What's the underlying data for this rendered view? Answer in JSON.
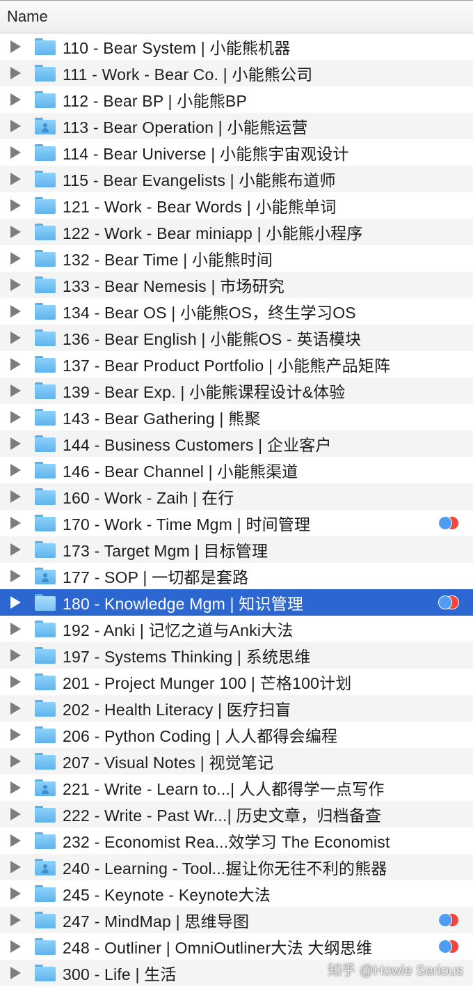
{
  "header": {
    "name_label": "Name"
  },
  "colors": {
    "selection": "#2b66d1",
    "folder": "#6fbff4",
    "tag_red": "#f0463c",
    "tag_blue": "#4e9df2"
  },
  "rows": [
    {
      "label": "110 - Bear System | 小能熊机器",
      "icon": "folder-icon",
      "tags": []
    },
    {
      "label": "111 - Work - Bear Co. | 小能熊公司",
      "icon": "folder-icon",
      "tags": []
    },
    {
      "label": "112  - Bear BP | 小能熊BP",
      "icon": "folder-icon",
      "tags": []
    },
    {
      "label": "113 - Bear Operation | 小能熊运营",
      "icon": "shared-folder-icon",
      "tags": []
    },
    {
      "label": "114 - Bear Universe | 小能熊宇宙观设计",
      "icon": "folder-icon",
      "tags": []
    },
    {
      "label": "115 - Bear Evangelists | 小能熊布道师",
      "icon": "folder-icon",
      "tags": []
    },
    {
      "label": "121 - Work - Bear Words | 小能熊单词",
      "icon": "folder-icon",
      "tags": []
    },
    {
      "label": "122 - Work - Bear miniapp | 小能熊小程序",
      "icon": "folder-icon",
      "tags": []
    },
    {
      "label": "132 - Bear Time | 小能熊时间",
      "icon": "folder-icon",
      "tags": []
    },
    {
      "label": "133 - Bear Nemesis | 市场研究",
      "icon": "folder-icon",
      "tags": []
    },
    {
      "label": "134 - Bear OS | 小能熊OS，终生学习OS",
      "icon": "folder-icon",
      "tags": []
    },
    {
      "label": "136 - Bear English | 小能熊OS - 英语模块",
      "icon": "folder-icon",
      "tags": []
    },
    {
      "label": "137 - Bear Product Portfolio | 小能熊产品矩阵",
      "icon": "folder-icon",
      "tags": []
    },
    {
      "label": "139 - Bear Exp. | 小能熊课程设计&体验",
      "icon": "folder-icon",
      "tags": []
    },
    {
      "label": "143 - Bear Gathering | 熊聚",
      "icon": "folder-icon",
      "tags": []
    },
    {
      "label": "144 - Business Customers | 企业客户",
      "icon": "folder-icon",
      "tags": []
    },
    {
      "label": "146 - Bear Channel | 小能熊渠道",
      "icon": "folder-icon",
      "tags": []
    },
    {
      "label": "160 - Work - Zaih | 在行",
      "icon": "folder-icon",
      "tags": []
    },
    {
      "label": "170 - Work - Time Mgm | 时间管理",
      "icon": "folder-icon",
      "tags": [
        "blue",
        "red"
      ]
    },
    {
      "label": "173 - Target Mgm | 目标管理",
      "icon": "folder-icon",
      "tags": []
    },
    {
      "label": "177 - SOP | 一切都是套路",
      "icon": "shared-folder-icon",
      "tags": []
    },
    {
      "label": "180 - Knowledge Mgm | 知识管理",
      "icon": "folder-icon",
      "tags": [
        "blue",
        "red"
      ],
      "selected": true
    },
    {
      "label": "192 - Anki | 记忆之道与Anki大法",
      "icon": "folder-icon",
      "tags": []
    },
    {
      "label": "197 - Systems Thinking | 系统思维",
      "icon": "folder-icon",
      "tags": []
    },
    {
      "label": "201 - Project Munger 100 | 芒格100计划",
      "icon": "folder-icon",
      "tags": []
    },
    {
      "label": "202 - Health Literacy | 医疗扫盲",
      "icon": "folder-icon",
      "tags": []
    },
    {
      "label": "206 - Python Coding | 人人都得会编程",
      "icon": "folder-icon",
      "tags": []
    },
    {
      "label": "207 - Visual Notes | 视觉笔记",
      "icon": "folder-icon",
      "tags": []
    },
    {
      "label": "221 - Write - Learn to...| 人人都得学一点写作",
      "icon": "shared-folder-icon",
      "tags": []
    },
    {
      "label": "222 - Write - Past Wr...| 历史文章，归档备查",
      "icon": "folder-icon",
      "tags": []
    },
    {
      "label": "232 - Economist Rea...效学习 The Economist",
      "icon": "folder-icon",
      "tags": []
    },
    {
      "label": "240 - Learning - Tool...握让你无往不利的熊器",
      "icon": "shared-folder-icon",
      "tags": []
    },
    {
      "label": "245 - Keynote - Keynote大法",
      "icon": "folder-icon",
      "tags": []
    },
    {
      "label": "247 - MindMap | 思维导图",
      "icon": "folder-icon",
      "tags": [
        "blue",
        "red"
      ]
    },
    {
      "label": "248 - Outliner | OmniOutliner大法 大纲思维",
      "icon": "folder-icon",
      "tags": [
        "blue",
        "red"
      ]
    },
    {
      "label": "300 - Life | 生活",
      "icon": "folder-icon",
      "tags": []
    }
  ],
  "watermark": "知乎 @Howie Serious"
}
